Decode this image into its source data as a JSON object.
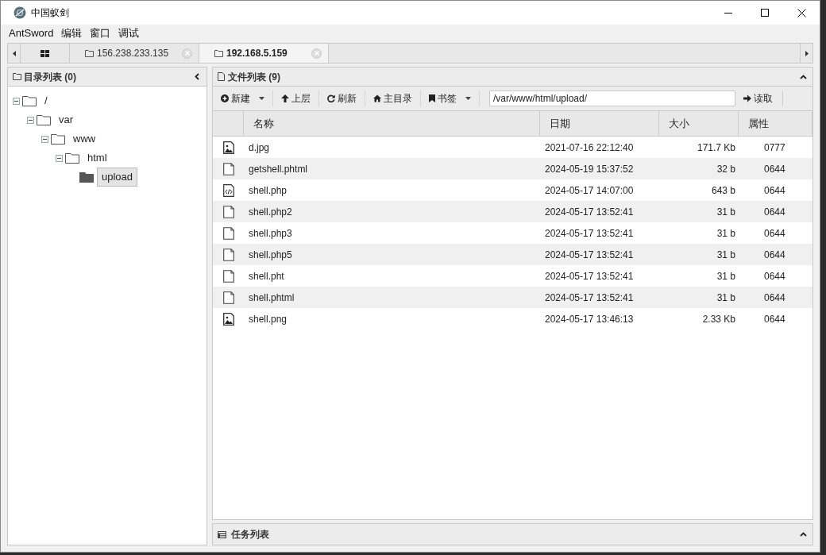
{
  "window": {
    "title": "中国蚁剑"
  },
  "menu": [
    "AntSword",
    "编辑",
    "窗口",
    "调试"
  ],
  "tabs": [
    {
      "kind": "home",
      "selected": false
    },
    {
      "kind": "host",
      "label": "156.238.233.135",
      "selected": false
    },
    {
      "kind": "host",
      "label": "192.168.5.159",
      "selected": true
    }
  ],
  "directory_panel": {
    "title": "目录列表 (0)",
    "tree": [
      {
        "label": "/",
        "expanded": true,
        "selected": false,
        "children": [
          {
            "label": "var",
            "expanded": true,
            "selected": false,
            "children": [
              {
                "label": "www",
                "expanded": true,
                "selected": false,
                "children": [
                  {
                    "label": "html",
                    "expanded": true,
                    "selected": false,
                    "children": [
                      {
                        "label": "upload",
                        "selected": true
                      }
                    ]
                  }
                ]
              }
            ]
          }
        ]
      }
    ]
  },
  "file_panel": {
    "title": "文件列表 (9)",
    "toolbar": [
      {
        "kind": "new",
        "label": "新建",
        "dropdown": true
      },
      {
        "kind": "up",
        "label": "上层",
        "dropdown": false
      },
      {
        "kind": "refresh",
        "label": "刷新",
        "dropdown": false
      },
      {
        "kind": "home",
        "label": "主目录",
        "dropdown": false
      },
      {
        "kind": "bookmark",
        "label": "书签",
        "dropdown": true
      }
    ],
    "path": "/var/www/html/upload/",
    "read_button": "读取",
    "columns": [
      "名称",
      "日期",
      "大小",
      "属性"
    ],
    "rows": [
      {
        "kind": "image",
        "name": "d.jpg",
        "date": "2021-07-16 22:12:40",
        "size": "171.7 Kb",
        "perm": "0777"
      },
      {
        "kind": "file",
        "name": "getshell.phtml",
        "date": "2024-05-19 15:37:52",
        "size": "32 b",
        "perm": "0644"
      },
      {
        "kind": "code",
        "name": "shell.php",
        "date": "2024-05-17 14:07:00",
        "size": "643 b",
        "perm": "0644"
      },
      {
        "kind": "file",
        "name": "shell.php2",
        "date": "2024-05-17 13:52:41",
        "size": "31 b",
        "perm": "0644"
      },
      {
        "kind": "file",
        "name": "shell.php3",
        "date": "2024-05-17 13:52:41",
        "size": "31 b",
        "perm": "0644"
      },
      {
        "kind": "file",
        "name": "shell.php5",
        "date": "2024-05-17 13:52:41",
        "size": "31 b",
        "perm": "0644"
      },
      {
        "kind": "file",
        "name": "shell.pht",
        "date": "2024-05-17 13:52:41",
        "size": "31 b",
        "perm": "0644"
      },
      {
        "kind": "file",
        "name": "shell.phtml",
        "date": "2024-05-17 13:52:41",
        "size": "31 b",
        "perm": "0644"
      },
      {
        "kind": "image",
        "name": "shell.png",
        "date": "2024-05-17 13:46:13",
        "size": "2.33 Kb",
        "perm": "0644"
      }
    ]
  },
  "task_panel": {
    "title": "任务列表"
  }
}
